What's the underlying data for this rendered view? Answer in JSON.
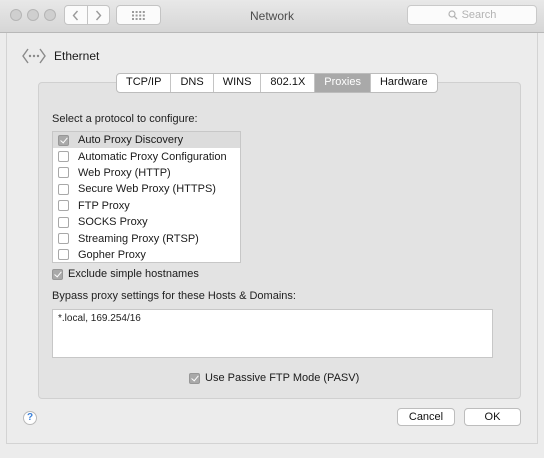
{
  "window": {
    "title": "Network"
  },
  "toolbar": {
    "search_placeholder": "Search"
  },
  "interface": {
    "name": "Ethernet"
  },
  "tabs": [
    {
      "label": "TCP/IP",
      "selected": false
    },
    {
      "label": "DNS",
      "selected": false
    },
    {
      "label": "WINS",
      "selected": false
    },
    {
      "label": "802.1X",
      "selected": false
    },
    {
      "label": "Proxies",
      "selected": true
    },
    {
      "label": "Hardware",
      "selected": false
    }
  ],
  "proxies": {
    "protocol_label": "Select a protocol to configure:",
    "protocols": [
      {
        "label": "Auto Proxy Discovery",
        "checked": true,
        "selected": true
      },
      {
        "label": "Automatic Proxy Configuration",
        "checked": false,
        "selected": false
      },
      {
        "label": "Web Proxy (HTTP)",
        "checked": false,
        "selected": false
      },
      {
        "label": "Secure Web Proxy (HTTPS)",
        "checked": false,
        "selected": false
      },
      {
        "label": "FTP Proxy",
        "checked": false,
        "selected": false
      },
      {
        "label": "SOCKS Proxy",
        "checked": false,
        "selected": false
      },
      {
        "label": "Streaming Proxy (RTSP)",
        "checked": false,
        "selected": false
      },
      {
        "label": "Gopher Proxy",
        "checked": false,
        "selected": false
      }
    ],
    "exclude_simple": {
      "label": "Exclude simple hostnames",
      "checked": true
    },
    "bypass_label": "Bypass proxy settings for these Hosts & Domains:",
    "bypass_value": "*.local, 169.254/16",
    "pasv": {
      "label": "Use Passive FTP Mode (PASV)",
      "checked": true
    }
  },
  "footer": {
    "help": "?",
    "cancel": "Cancel",
    "ok": "OK"
  },
  "colors": {
    "selected_tab": "#a9a9a9",
    "panel": "#e3e3e3",
    "help_accent": "#3b80d9"
  }
}
